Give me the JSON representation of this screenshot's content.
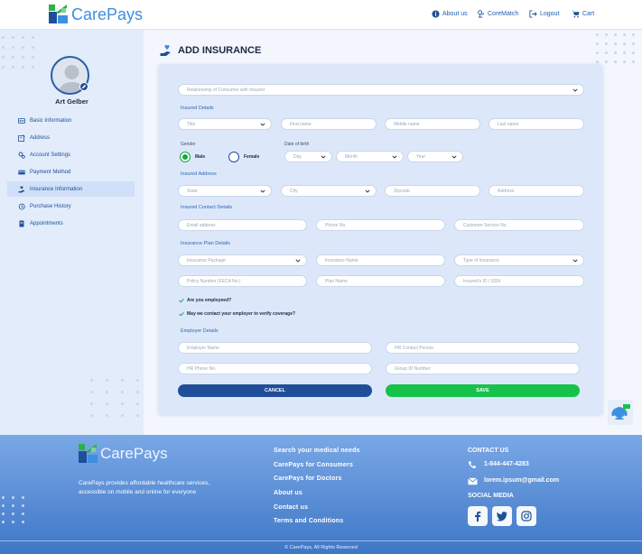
{
  "brand": {
    "name": "CarePays",
    "primary": "#3d8fe0",
    "secondary": "#2ab34a",
    "dark": "#1f4f98"
  },
  "header": {
    "nav": [
      {
        "label": "About us",
        "icon": "info-icon"
      },
      {
        "label": "CoreMatch",
        "icon": "coremedic-icon"
      },
      {
        "label": "Logout",
        "icon": "logout-icon"
      },
      {
        "label": "Cart",
        "icon": "cart-icon"
      }
    ]
  },
  "sidebar": {
    "user_name": "Art Gelber",
    "items": [
      {
        "label": "Basic Information",
        "icon": "id-card-icon"
      },
      {
        "label": "Address",
        "icon": "address-icon"
      },
      {
        "label": "Account Settings",
        "icon": "settings-icon"
      },
      {
        "label": "Payment Method",
        "icon": "card-icon"
      },
      {
        "label": "Insurance Information",
        "icon": "insurance-icon",
        "active": true
      },
      {
        "label": "Purchase History",
        "icon": "history-icon"
      },
      {
        "label": "Appointments",
        "icon": "appointment-icon"
      }
    ]
  },
  "main": {
    "title": "ADD INSURANCE",
    "relationship_placeholder": "Relationship of Consumer with Insured",
    "insured_details_label": "Insured Details",
    "title_placeholder": "Title",
    "first_name_placeholder": "First name",
    "middle_name_placeholder": "Middle name",
    "last_name_placeholder": "Last name",
    "gender_label": "Gender",
    "gender_options": [
      "Male",
      "Female"
    ],
    "gender_selected": "Male",
    "dob_label": "Date of birth",
    "day_placeholder": "Day",
    "month_placeholder": "Month",
    "year_placeholder": "Year",
    "insured_address_label": "Insured Address",
    "state_placeholder": "State",
    "city_placeholder": "City",
    "zip_placeholder": "Zipcode",
    "address_placeholder": "Address",
    "contact_label": "Insured Contact Details",
    "email_placeholder": "Email address",
    "phone_placeholder": "Phone No.",
    "customer_service_placeholder": "Customer Service No.",
    "plan_label": "Insurance Plan Details",
    "package_placeholder": "Insurance Package",
    "insurance_name_placeholder": "Insurance Name",
    "type_placeholder": "Type of Insurance",
    "policy_placeholder": "Policy Number (FECA No.)",
    "plan_name_placeholder": "Plan Name",
    "insured_id_placeholder": "Insured's ID / SSN",
    "employed_question": "Are you employeed?",
    "contact_employer_question": "May we contact your employer to verify coverage?",
    "employer_label": "Employer Details",
    "employer_name_placeholder": "Employer Name",
    "hr_contact_placeholder": "HR Contact Person",
    "hr_phone_placeholder": "HR Phone No.",
    "group_id_placeholder": "Group ID Number",
    "cancel_label": "CANCEL",
    "save_label": "SAVE",
    "cancel_color": "#1f4f98",
    "save_color": "#16c24a"
  },
  "footer": {
    "brand": "CarePays",
    "description": "CarePays provides affordable healthcare services, accessible on mobile and online for everyone",
    "links": [
      "Search your medical needs",
      "CarePays for Consumers",
      "CarePays for Doctors",
      "About us",
      "Contact us",
      "Terms and Conditions"
    ],
    "contact_title": "CONTACT US",
    "phone": "1-844-447-4283",
    "email": "lorem.ipsum@gmail.com",
    "social_title": "SOCIAL MEDIA",
    "social": [
      "facebook-icon",
      "twitter-icon",
      "instagram-icon"
    ],
    "copyright": "© CarePays, All Rights Reserved"
  }
}
